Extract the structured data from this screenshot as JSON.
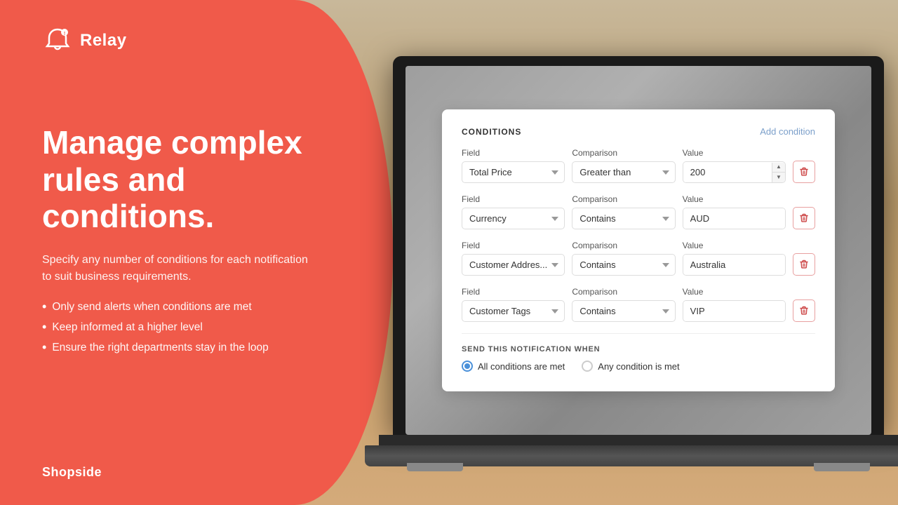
{
  "brand": {
    "logo_text": "Relay",
    "shopside_text": "Shopside"
  },
  "left_panel": {
    "headline": "Manage complex rules and conditions.",
    "subtext": "Specify any number of conditions for each notification to suit business requirements.",
    "bullets": [
      "Only send alerts when conditions are met",
      "Keep informed at a higher level",
      "Ensure the right departments stay in the loop"
    ]
  },
  "conditions_card": {
    "title": "CONDITIONS",
    "add_condition_label": "Add condition",
    "column_headers": {
      "field": "Field",
      "comparison": "Comparison",
      "value": "Value"
    },
    "rows": [
      {
        "field": "Total Price",
        "comparison": "Greater than",
        "value": "200",
        "has_spinner": true
      },
      {
        "field": "Currency",
        "comparison": "Contains",
        "value": "AUD",
        "has_spinner": false
      },
      {
        "field": "Customer Addres...",
        "comparison": "Contains",
        "value": "Australia",
        "has_spinner": false
      },
      {
        "field": "Customer Tags",
        "comparison": "Contains",
        "value": "VIP",
        "has_spinner": false
      }
    ],
    "send_section": {
      "title": "SEND THIS NOTIFICATION WHEN",
      "options": [
        {
          "label": "All conditions are met",
          "checked": true
        },
        {
          "label": "Any condition is met",
          "checked": false
        }
      ]
    }
  },
  "colors": {
    "coral": "#f05a4a",
    "link_blue": "#7b9fca",
    "radio_blue": "#4a90d9"
  }
}
